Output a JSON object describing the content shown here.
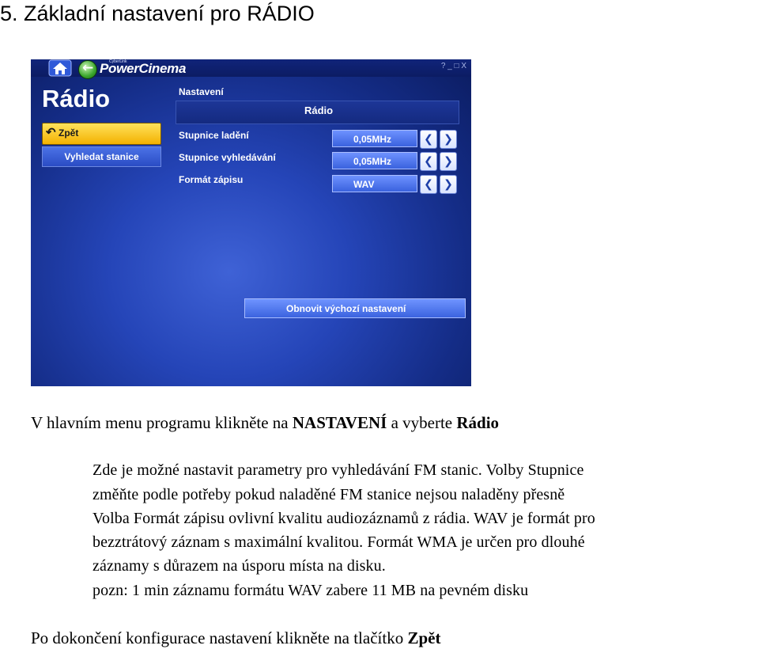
{
  "heading": "5. Základní nastavení pro RÁDIO",
  "screenshot": {
    "brand_small": "CyberLink",
    "brand": "PowerCinema",
    "window_controls": "? _ □ X",
    "page_title": "Rádio",
    "back_button": "Zpět",
    "scan_button": "Vyhledat stanice",
    "section_label": "Nastavení",
    "section_value": "Rádio",
    "rows": [
      {
        "label": "Stupnice ladění",
        "value": "0,05MHz"
      },
      {
        "label": "Stupnice vyhledávání",
        "value": "0,05MHz"
      },
      {
        "label": "Formát zápisu",
        "value": "WAV"
      }
    ],
    "restore_button": "Obnovit výchozí nastavení"
  },
  "instruction": {
    "pre": "V hlavním menu programu klikněte na ",
    "bold1": "NASTAVENÍ",
    "mid": " a vyberte ",
    "bold2": "Rádio"
  },
  "paragraph_lines": [
    "Zde je možné nastavit parametry pro vyhledávání FM stanic. Volby Stupnice",
    "změňte podle potřeby pokud naladěné FM stanice nejsou naladěny přesně",
    "Volba Formát zápisu ovlivní kvalitu audiozáznamů z rádia. WAV je formát pro",
    "bezztrátový záznam s maximální kvalitou. Formát WMA je určen pro dlouhé",
    "záznamy s důrazem na úsporu místa na disku.",
    "pozn: 1 min záznamu formátu WAV zabere 11 MB na pevném disku"
  ],
  "closing": {
    "pre": "Po dokončení konfigurace nastavení klikněte na tlačítko ",
    "bold": "Zpět"
  }
}
